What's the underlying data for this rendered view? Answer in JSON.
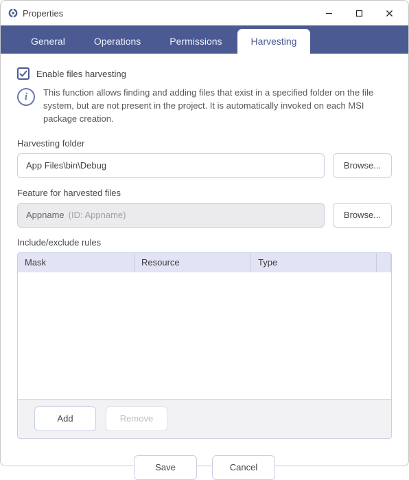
{
  "window": {
    "title": "Properties"
  },
  "tabs": {
    "general": "General",
    "operations": "Operations",
    "permissions": "Permissions",
    "harvesting": "Harvesting",
    "active": "harvesting"
  },
  "harvesting": {
    "enable_label": "Enable files harvesting",
    "enabled": true,
    "info_text": "This function allows finding and adding files that exist in a specified folder on the file system, but are not present in the project. It is automatically invoked on each MSI package creation.",
    "folder_label": "Harvesting folder",
    "folder_value": "App Files\\bin\\Debug",
    "browse_label": "Browse...",
    "feature_label": "Feature for harvested files",
    "feature_value": "Appname",
    "feature_id_hint": "(ID: Appname)",
    "rules_label": "Include/exclude rules",
    "columns": {
      "mask": "Mask",
      "resource": "Resource",
      "type": "Type"
    },
    "rules": [],
    "add_label": "Add",
    "remove_label": "Remove"
  },
  "footer": {
    "save": "Save",
    "cancel": "Cancel"
  }
}
